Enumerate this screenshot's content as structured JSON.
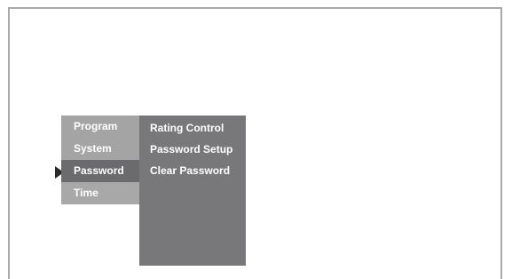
{
  "menu": {
    "items": [
      {
        "label": "Program"
      },
      {
        "label": "System"
      },
      {
        "label": "Password"
      },
      {
        "label": "Time"
      }
    ],
    "selected": "Password"
  },
  "submenu": {
    "items": [
      {
        "label": "Rating Control"
      },
      {
        "label": "Password Setup"
      },
      {
        "label": "Clear Password"
      }
    ]
  },
  "icons": {
    "pointer": "selection-arrow-icon"
  },
  "colors": {
    "menu_bg": "#a4a4a4",
    "menu_selected_bg": "#6b6b6d",
    "submenu_bg": "#78787a",
    "text": "#ffffff",
    "frame_border": "#a9a9a9"
  }
}
